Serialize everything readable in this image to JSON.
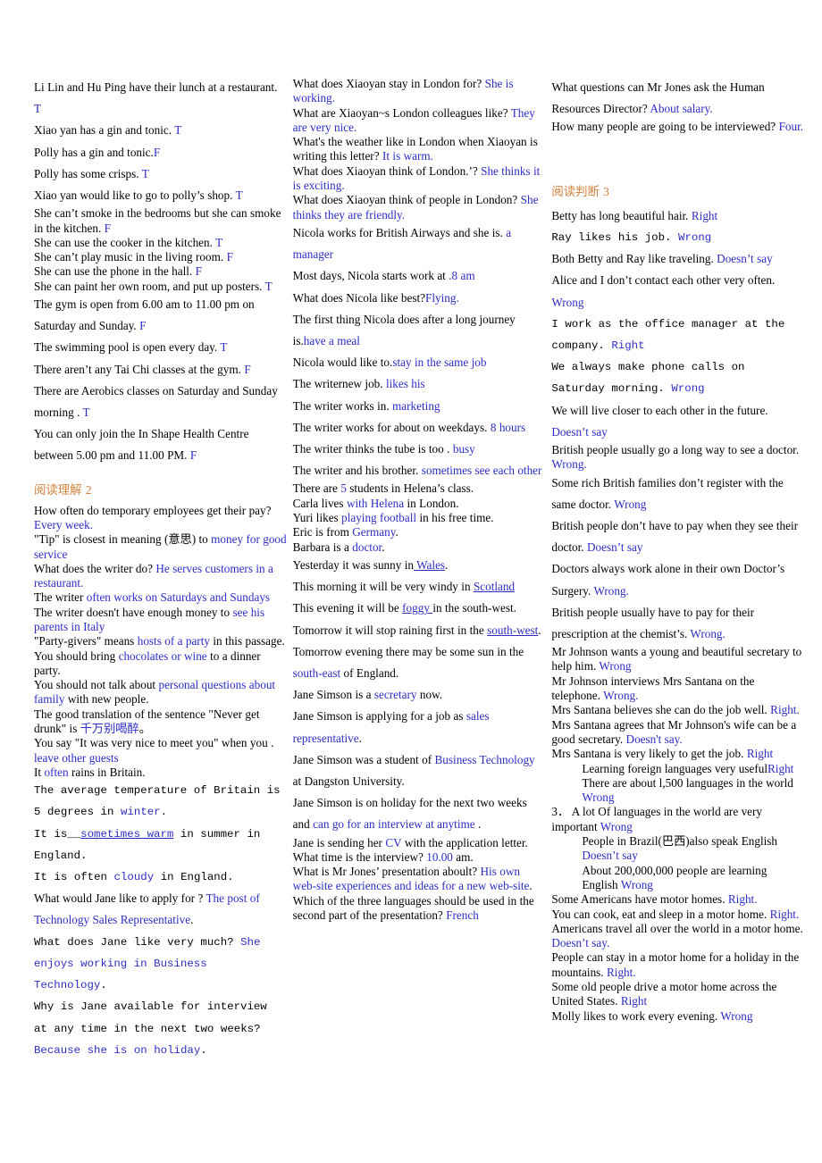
{
  "page": {
    "background": "#ffffff",
    "answer_color": "#2d2dc4",
    "heading_color": "#d0833e",
    "text_color": "#000000"
  },
  "columns": [
    {
      "id": "column-1",
      "blocks": [
        {
          "type": "line",
          "spacing": "loose",
          "q": "Li Lin and Hu Ping have their lunch at a restaurant. ",
          "a": "T"
        },
        {
          "type": "line",
          "spacing": "loose",
          "q": "Xiao yan has a gin and tonic. ",
          "a": "T"
        },
        {
          "type": "line",
          "spacing": "loose",
          "q": "Polly has a gin and tonic.",
          "a": "F"
        },
        {
          "type": "line",
          "spacing": "loose",
          "q": "Polly has some crisps. ",
          "a": "T"
        },
        {
          "type": "line",
          "spacing": "loose",
          "q": "Xiao yan would like to go to polly’s shop. ",
          "a": "T"
        },
        {
          "type": "line",
          "spacing": "tight",
          "q": "She can’t smoke in the bedrooms but she can smoke in the kitchen. ",
          "a": "F"
        },
        {
          "type": "line",
          "spacing": "tight",
          "q": "She can use the cooker in the kitchen. ",
          "a": "T"
        },
        {
          "type": "line",
          "spacing": "tight",
          "q": "She can’t play music in the living room. ",
          "a": "F"
        },
        {
          "type": "line",
          "spacing": "tight",
          "q": "She can use the phone in the hall. ",
          "a": "F"
        },
        {
          "type": "line",
          "spacing": "tight",
          "q": "She can paint her own room, and put up posters. ",
          "a": "T"
        },
        {
          "type": "line",
          "spacing": "loose",
          "q": "The gym is open from 6.00 am to 11.00 pm on Saturday and    Sunday. ",
          "a": "F"
        },
        {
          "type": "line",
          "spacing": "loose",
          "q": "The swimming pool is open every day. ",
          "a": "T"
        },
        {
          "type": "line",
          "spacing": "loose",
          "q": "There aren’t any Tai Chi classes at the gym. ",
          "a": "F"
        },
        {
          "type": "line",
          "spacing": "loose",
          "q": "There are Aerobics classes on Saturday and Sunday morning . ",
          "a": "T"
        },
        {
          "type": "line",
          "spacing": "loose",
          "q": "You can only join the In Shape Health Centre between 5.00 pm and 11.00 PM. ",
          "a": "F"
        },
        {
          "type": "heading",
          "text": "阅读理解 ",
          "num": "2"
        },
        {
          "type": "line",
          "spacing": "tight",
          "q": "How often do temporary employees get their pay? ",
          "a": "Every week."
        },
        {
          "type": "line",
          "spacing": "tight",
          "q": "\"Tip\" is closest in meaning (意思) to ",
          "a": "money for good service"
        },
        {
          "type": "line",
          "spacing": "tight",
          "q": "What does the writer do? ",
          "a": "He serves customers in a restaurant."
        },
        {
          "type": "line",
          "spacing": "tight",
          "q": "The writer ",
          "a": "often works on Saturdays and Sundays"
        },
        {
          "type": "line",
          "spacing": "tight",
          "q": "The writer doesn't have enough money to ",
          "a": "see his parents in Italy"
        },
        {
          "type": "line",
          "spacing": "tight",
          "q": "\"Party-givers\" means ",
          "a": "hosts of a party",
          "tail": " in this passage."
        },
        {
          "type": "line",
          "spacing": "tight",
          "q": "You should bring ",
          "a": "chocolates or wine",
          "tail": " to a dinner party."
        },
        {
          "type": "line",
          "spacing": "tight",
          "q": "You should not talk about ",
          "a": "personal questions about family",
          "tail": " with new people."
        },
        {
          "type": "line",
          "spacing": "tight",
          "q": "The good translation of the sentence \"Never get drunk\" is ",
          "a": "千万别喝醉",
          "tail": "。"
        },
        {
          "type": "line",
          "spacing": "tight",
          "q": "You say \"It was very nice to meet you\" when you . ",
          "a": "leave other guests"
        },
        {
          "type": "line",
          "spacing": "tight",
          "q": "It ",
          "a": "often",
          "tail": " rains in Britain."
        },
        {
          "type": "line",
          "spacing": "mono",
          "q": "The average temperature of Britain is 5 degrees in ",
          "a": "winter",
          "tail": "."
        },
        {
          "type": "line",
          "spacing": "mono",
          "q": "It is__",
          "a": "sometimes warm",
          "a_underline": true,
          "tail": "  in summer in England."
        },
        {
          "type": "line",
          "spacing": "mono",
          "q": "It is often ",
          "a": "cloudy",
          "tail": "     in England."
        },
        {
          "type": "line",
          "spacing": "loose",
          "q": "What would Jane like to apply for ? ",
          "a": "The post of Technology Sales Representative",
          "tail": "."
        },
        {
          "type": "line",
          "spacing": "mono",
          "q": "What does Jane like very much? ",
          "a": "She enjoys working in Business Technology",
          "tail": "."
        },
        {
          "type": "line",
          "spacing": "mono",
          "q": "Why is Jane available for interview at any time in the next two weeks? ",
          "a": "Because she is on holiday",
          "tail": "."
        }
      ]
    },
    {
      "id": "column-2",
      "blocks": [
        {
          "type": "line",
          "spacing": "tight",
          "q": "What does Xiaoyan stay in London for? ",
          "a": "She is working."
        },
        {
          "type": "line",
          "spacing": "tight",
          "q": "What are Xiaoyan~s London colleagues like? ",
          "a": "They are very nice."
        },
        {
          "type": "line",
          "spacing": "tight",
          "q": "What's the weather like in London when Xiaoyan is writing this letter? ",
          "a": "It is warm."
        },
        {
          "type": "line",
          "spacing": "tight",
          "q": "What does Xiaoyan think of London.’? ",
          "a": "She thinks it is exciting."
        },
        {
          "type": "line",
          "spacing": "tight",
          "q": "What does Xiaoyan think of people in London? ",
          "a": "She thinks they are friendly."
        },
        {
          "type": "line",
          "spacing": "loose",
          "q": "Nicola works for British Airways and she is. ",
          "a": "a manager"
        },
        {
          "type": "line",
          "spacing": "loose",
          "q": "Most days, Nicola starts work at ",
          "a": ".8 am"
        },
        {
          "type": "line",
          "spacing": "loose",
          "q": "What does Nicola like best?",
          "a": "Flying."
        },
        {
          "type": "line",
          "spacing": "loose",
          "q": "The first thing Nicola does after a long journey is.",
          "a": "have a meal"
        },
        {
          "type": "line",
          "spacing": "loose",
          "q": "Nicola would like to.",
          "a": "stay in the same job"
        },
        {
          "type": "line",
          "spacing": "loose",
          "q": "The writernew job. ",
          "a": "likes his"
        },
        {
          "type": "line",
          "spacing": "loose",
          "q": "The writer works in. ",
          "a": "marketing"
        },
        {
          "type": "line",
          "spacing": "loose",
          "q": "The writer works for about on weekdays. ",
          "a": "8 hours"
        },
        {
          "type": "line",
          "spacing": "loose",
          "q": "The writer thinks the tube is too . ",
          "a": "busy"
        },
        {
          "type": "line",
          "spacing": "loose",
          "q": "The writer and his brother. ",
          "a": "sometimes see each other"
        },
        {
          "type": "line",
          "spacing": "tight",
          "q": "There are ",
          "a": "5",
          "tail": " students in Helena’s class."
        },
        {
          "type": "line",
          "spacing": "tight",
          "q": "Carla lives ",
          "a": "with Helena",
          "tail": " in London."
        },
        {
          "type": "line",
          "spacing": "tight",
          "q": "Yuri likes ",
          "a": "playing football",
          "tail": " in his free time."
        },
        {
          "type": "line",
          "spacing": "tight",
          "q": "Eric is from ",
          "a": "Germany",
          "tail": "."
        },
        {
          "type": "line",
          "spacing": "tight",
          "q": "Barbara is a ",
          "a": "doctor",
          "tail": "."
        },
        {
          "type": "line",
          "spacing": "loose",
          "q": "Yesterday it was sunny in",
          "a": " Wales",
          "a_underline": true,
          "tail": "."
        },
        {
          "type": "line",
          "spacing": "loose",
          "q": "This morning it will be very windy in ",
          "a": "Scotland",
          "a_underline": true
        },
        {
          "type": "line",
          "spacing": "loose",
          "q": "This evening it will be ",
          "a": "foggy ",
          "a_underline": true,
          "tail": "in the south-west."
        },
        {
          "type": "line",
          "spacing": "loose",
          "q": "Tomorrow it will stop raining first in the ",
          "a": "south-west",
          "a_underline": true,
          "tail": "."
        },
        {
          "type": "line",
          "spacing": "loose",
          "q": "Tomorrow evening there may be some sun in the ",
          "a": "south-east",
          "tail": " of England."
        },
        {
          "type": "line",
          "spacing": "loose",
          "q": "Jane Simson is a",
          "a": " secretary",
          "tail": " now."
        },
        {
          "type": "line",
          "spacing": "loose",
          "q": "Jane Simson is applying for a job as ",
          "a": "sales representative",
          "tail": "."
        },
        {
          "type": "line",
          "spacing": "loose",
          "q": "Jane Simson was a student of",
          "a": " Business Technology ",
          "tail": "at Dangston University."
        },
        {
          "type": "line",
          "spacing": "loose",
          "q": "Jane Simson is on holiday for the next two weeks and ",
          "a": "can go for an interview at anytime ",
          "tail": "."
        },
        {
          "type": "line",
          "spacing": "tight",
          "q": "Jane is sending her",
          "a": " CV ",
          "tail": "with the application letter."
        },
        {
          "type": "line",
          "spacing": "tight",
          "q": "What time is the interview? ",
          "a": "10.00",
          "tail": " am."
        },
        {
          "type": "line",
          "spacing": "tight",
          "q": "What is Mr Jones’ presentation aboult? ",
          "a": "His own web-site experiences and ideas for a new web-site",
          "tail": "."
        },
        {
          "type": "line",
          "spacing": "tight",
          "q": "Which of the three languages should be used in the second part of the presentation? ",
          "a": "French"
        }
      ]
    },
    {
      "id": "column-3",
      "blocks": [
        {
          "type": "line",
          "spacing": "loose",
          "q": "What questions can Mr Jones ask the Human Resources Director? ",
          "a": "About salary."
        },
        {
          "type": "line",
          "spacing": "tight",
          "q": "How many people are going to be interviewed? ",
          "a": "Four."
        },
        {
          "type": "spacer",
          "size": "large"
        },
        {
          "type": "heading",
          "text": "阅读判断 ",
          "num": "3"
        },
        {
          "type": "line",
          "spacing": "loose",
          "q": "Betty has long beautiful hair. ",
          "a": "Right"
        },
        {
          "type": "line",
          "spacing": "mono",
          "q": "Ray likes his job. ",
          "a": "Wrong"
        },
        {
          "type": "line",
          "spacing": "loose",
          "q": "Both Betty and Ray like traveling. ",
          "a": "Doesn’t say"
        },
        {
          "type": "line",
          "spacing": "loose",
          "q": "Alice and I don’t contact each other very often. ",
          "a": "Wrong"
        },
        {
          "type": "line",
          "spacing": "mono",
          "q": "I work as the office manager at the company.  ",
          "a": "Right"
        },
        {
          "type": "line",
          "spacing": "mono",
          "q": "We always make phone calls on Saturday morning.  ",
          "a": "Wrong"
        },
        {
          "type": "line",
          "spacing": "loose",
          "q": "We will live closer to each other in the future. ",
          "a": "Doesn’t say"
        },
        {
          "type": "line",
          "spacing": "tight",
          "q": "British people usually go a long way to see a doctor. ",
          "a": "Wrong."
        },
        {
          "type": "line",
          "spacing": "loose",
          "q": "Some rich British families don’t register with the same doctor. ",
          "a": "Wrong"
        },
        {
          "type": "line",
          "spacing": "loose",
          "q": "British people don’t have to pay when they see their doctor. ",
          "a": "Doesn’t say"
        },
        {
          "type": "line",
          "spacing": "loose",
          "q": "Doctors always work alone in their own Doctor’s Surgery. ",
          "a": "Wrong."
        },
        {
          "type": "line",
          "spacing": "loose",
          "q": "British people usually have to pay for their prescription at the chemist’s. ",
          "a": "Wrong."
        },
        {
          "type": "line",
          "spacing": "tight",
          "q": "Mr Johnson wants a young and beautiful secretary to help him. ",
          "a": "Wrong"
        },
        {
          "type": "line",
          "spacing": "tight",
          "q": "Mr Johnson interviews Mrs Santana on the telephone. ",
          "a": "Wrong."
        },
        {
          "type": "line",
          "spacing": "tight",
          "q": "Mrs Santana believes she can do the job well. ",
          "a": "Right."
        },
        {
          "type": "line",
          "spacing": "tight",
          "q": "Mrs Santana agrees that Mr Johnson's wife can be a good secretary. ",
          "a": "Doesn't say."
        },
        {
          "type": "line",
          "spacing": "tight",
          "q": "Mrs Santana is very likely to get the job. ",
          "a": "Right"
        },
        {
          "type": "line",
          "spacing": "tight",
          "indent": true,
          "q": "Learning foreign languages very useful",
          "a": "Right"
        },
        {
          "type": "line",
          "spacing": "tight",
          "indent": true,
          "q": "There are about l,500 languages in the world ",
          "a": "Wrong"
        },
        {
          "type": "line",
          "spacing": "tight",
          "q": "3．  A lot Of languages in the world are very important ",
          "a": "Wrong"
        },
        {
          "type": "line",
          "spacing": "tight",
          "indent": true,
          "q": "People in Brazil(巴西)also speak English ",
          "a": "Doesn’t say"
        },
        {
          "type": "line",
          "spacing": "tight",
          "indent": true,
          "q": "About 200,000,000 people are learning English ",
          "a": "Wrong"
        },
        {
          "type": "line",
          "spacing": "tight",
          "q": "Some Americans have motor homes. ",
          "a": "Right."
        },
        {
          "type": "line",
          "spacing": "tight",
          "q": "You can cook, eat and sleep in a motor home. ",
          "a": "Right."
        },
        {
          "type": "line",
          "spacing": "tight",
          "q": "Americans travel all over the world in a motor home. ",
          "a": "Doesn’t say."
        },
        {
          "type": "line",
          "spacing": "tight",
          "q": "People can stay in a motor home for a holiday in the mountains. ",
          "a": "Right."
        },
        {
          "type": "line",
          "spacing": "tight",
          "q": "Some old people drive a motor home across the United States. ",
          "a": "Right"
        },
        {
          "type": "line",
          "spacing": "tight",
          "q": "Molly likes to work every evening. ",
          "a": "Wrong"
        }
      ]
    }
  ]
}
